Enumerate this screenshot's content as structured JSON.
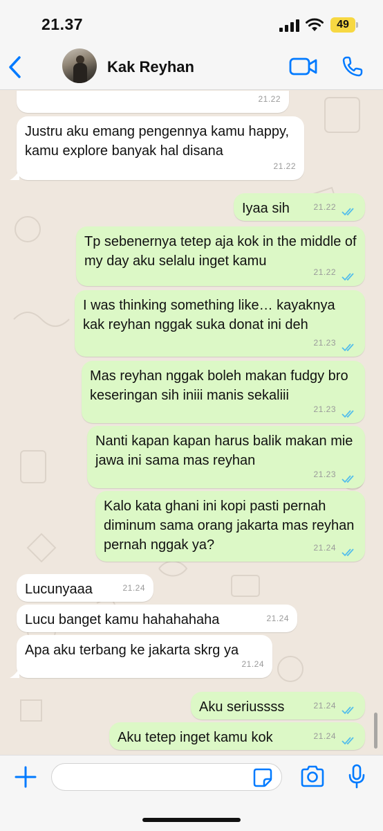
{
  "status_bar": {
    "time": "21.37",
    "battery": "49"
  },
  "header": {
    "contact_name": "Kak Reyhan"
  },
  "messages": [
    {
      "dir": "in",
      "text": "",
      "time": "21.22"
    },
    {
      "dir": "in",
      "text": "Justru aku emang pengennya kamu happy, kamu explore banyak hal disana",
      "time": "21.22"
    },
    {
      "dir": "out",
      "text": "Iyaa sih",
      "time": "21.22"
    },
    {
      "dir": "out",
      "text": "Tp sebenernya tetep aja kok in the middle of my day aku selalu inget kamu",
      "time": "21.22"
    },
    {
      "dir": "out",
      "text": "I was thinking something like… kayaknya kak reyhan nggak suka donat ini deh",
      "time": "21.23"
    },
    {
      "dir": "out",
      "text": "Mas reyhan nggak boleh makan fudgy bro keseringan sih iniii manis sekaliii",
      "time": "21.23"
    },
    {
      "dir": "out",
      "text": "Nanti kapan kapan harus balik makan mie jawa ini sama mas reyhan",
      "time": "21.23"
    },
    {
      "dir": "out",
      "text": "Kalo kata ghani ini kopi pasti pernah diminum sama orang jakarta mas reyhan pernah nggak ya?",
      "time": "21.24"
    },
    {
      "dir": "in",
      "text": "Lucunyaaa",
      "time": "21.24"
    },
    {
      "dir": "in",
      "text": "Lucu banget kamu hahahahaha",
      "time": "21.24"
    },
    {
      "dir": "in",
      "text": "Apa aku terbang ke jakarta skrg ya",
      "time": "21.24"
    },
    {
      "dir": "out",
      "text": "Aku seriussss",
      "time": "21.24"
    },
    {
      "dir": "out",
      "text": "Aku tetep inget kamu kok",
      "time": "21.24"
    }
  ],
  "input": {
    "placeholder": ""
  },
  "colors": {
    "accent": "#007aff",
    "outgoing_bubble": "#dcf8c6",
    "incoming_bubble": "#ffffff",
    "chat_background": "#efe7de",
    "read_ticks": "#53bdeb",
    "battery": "#f7d842"
  },
  "icons": [
    "signal-icon",
    "wifi-icon",
    "back-icon",
    "video-call-icon",
    "phone-call-icon",
    "plus-icon",
    "sticker-icon",
    "camera-icon",
    "microphone-icon",
    "double-check-icon"
  ]
}
